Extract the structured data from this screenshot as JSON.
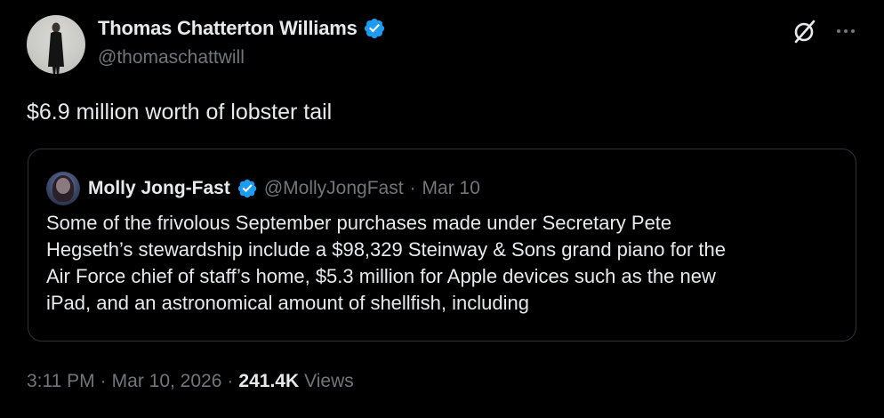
{
  "tweet": {
    "author_name": "Thomas Chatterton Williams",
    "author_handle": "@thomaschattwill",
    "text": "$6.9 million worth of lobster tail",
    "time": "3:11 PM",
    "date": "Mar 10, 2026",
    "separator": "·",
    "views_count": "241.4K",
    "views_label": "Views"
  },
  "quote": {
    "author_name": "Molly Jong-Fast",
    "author_handle": "@MollyJongFast",
    "separator": "·",
    "date": "Mar 10",
    "text_lines": [
      "Some of the frivolous September purchases made under Secretary Pete",
      "Hegseth’s stewardship include a $98,329 Steinway & Sons grand piano for the",
      "Air Force chief of staff’s home, $5.3 million for Apple devices such as the new",
      "iPad, and an astronomical amount of shellfish, including"
    ]
  },
  "icons": {
    "verified": "verified-badge-icon",
    "grok": "grok-icon",
    "more": "more-options-icon"
  },
  "colors": {
    "background": "#000000",
    "primary_text": "#e7e9ea",
    "secondary_text": "#71767b",
    "verified_blue": "#1d9bf0",
    "border": "#2f3336"
  }
}
